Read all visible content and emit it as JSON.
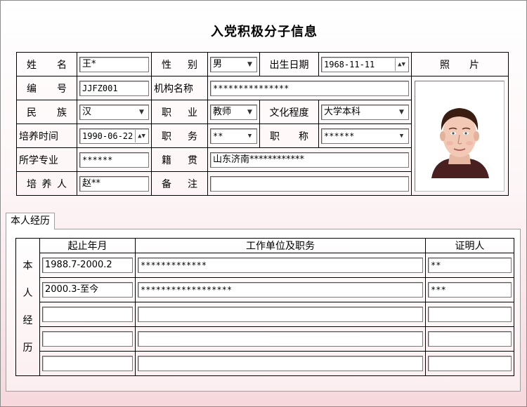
{
  "title": "入党积极分子信息",
  "labels": {
    "name": "姓名",
    "gender": "性别",
    "birth_date": "出生日期",
    "photo": "照片",
    "number": "编号",
    "org_name": "机构名称",
    "ethnicity": "民族",
    "occupation": "职业",
    "education": "文化程度",
    "training_time": "培养时间",
    "position": "职务",
    "title": "职称",
    "major": "所学专业",
    "native_place": "籍贯",
    "trainer": "培养人",
    "remarks": "备注"
  },
  "values": {
    "name": "王*",
    "gender": "男",
    "birth_date": "1968-11-11",
    "number": "JJFZ001",
    "org_name": "***************",
    "ethnicity": "汉",
    "occupation": "教师",
    "education": "大学本科",
    "training_time": "1990-06-22",
    "position": "**",
    "title": "******",
    "major": "******",
    "native_place": "山东济南************",
    "trainer": "赵**",
    "remarks": ""
  },
  "tab": {
    "label": "本人经历"
  },
  "history": {
    "side_label": [
      "本",
      "人",
      "经",
      "历"
    ],
    "columns": [
      "起止年月",
      "工作单位及职务",
      "证明人"
    ],
    "rows": [
      {
        "period": "1988.7-2000.2",
        "unit": "*************",
        "witness": "**"
      },
      {
        "period": "2000.3-至今",
        "unit": "******************",
        "witness": "***"
      },
      {
        "period": "",
        "unit": "",
        "witness": ""
      },
      {
        "period": "",
        "unit": "",
        "witness": ""
      },
      {
        "period": "",
        "unit": "",
        "witness": ""
      }
    ]
  }
}
